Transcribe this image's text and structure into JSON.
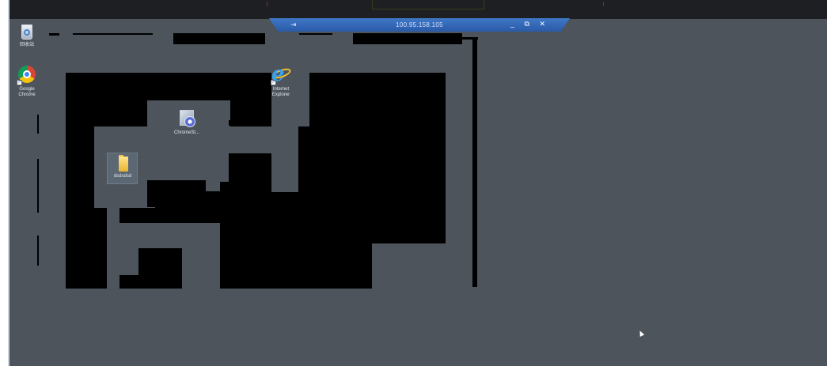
{
  "rdp_bar": {
    "pin_glyph": "⇥",
    "address": "100.95.158.105",
    "controls": "_ ⧉ ✕"
  },
  "icons": {
    "recycle_bin": {
      "label": "回收站",
      "icon": "recycle-bin-icon"
    },
    "google_chrome": {
      "label": "Google\nChrome",
      "icon": "chrome-icon"
    },
    "internet_explorer": {
      "label": "Internet\nExplorer",
      "icon": "ie-icon"
    },
    "chrome_setup": {
      "label": "ChromeSt...",
      "icon": "installer-icon"
    },
    "folder": {
      "label": "dsdsdsd",
      "icon": "folder-icon"
    }
  },
  "colors": {
    "desktop": "#4d545c",
    "rdp_bar": "#2a5aa8",
    "host_bar": "#1e1f22"
  }
}
